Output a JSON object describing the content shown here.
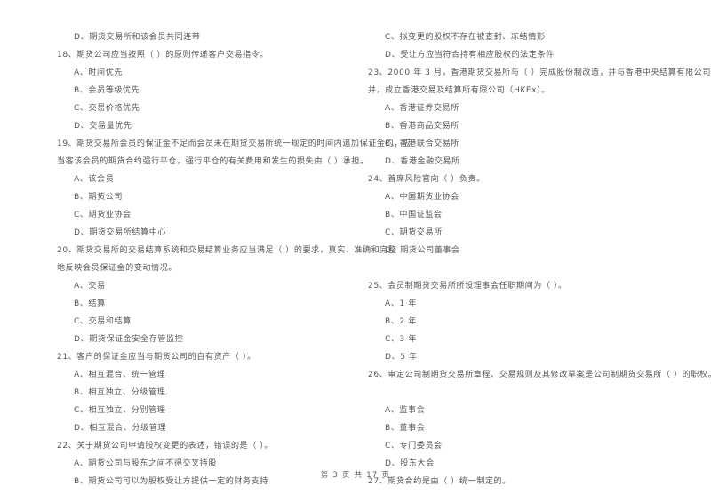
{
  "document": {
    "type": "exam-paper",
    "language": "zh-CN",
    "page_label": "第 3 页 共 17 页"
  },
  "left_column": {
    "lines": [
      {
        "kind": "option",
        "text": "D、期货交易所和该会员共同连带"
      },
      {
        "kind": "question",
        "text": "18、期货公司应当按照（    ）的原则传递客户交易指令。"
      },
      {
        "kind": "option",
        "text": "A、时间优先"
      },
      {
        "kind": "option",
        "text": "B、会员等级优先"
      },
      {
        "kind": "option",
        "text": "C、交易价格优先"
      },
      {
        "kind": "option",
        "text": "D、交易量优先"
      },
      {
        "kind": "question",
        "text": "19、期货交易所会员的保证金不足而会员未在期货交易所统一规定的时间内追加保证金的，应"
      },
      {
        "kind": "cont",
        "text": "当客该会员的期货合约强行平仓。强行平仓的有关费用和发生的损失由（    ）承担。"
      },
      {
        "kind": "option",
        "text": "A、该会员"
      },
      {
        "kind": "option",
        "text": "B、期货公司"
      },
      {
        "kind": "option",
        "text": "C、期货业协会"
      },
      {
        "kind": "option",
        "text": "D、期货交易所结算中心"
      },
      {
        "kind": "question",
        "text": "20、期货交易所的交易结算系统和交易结算业务应当满足（    ）的要求，真实、准确和完整"
      },
      {
        "kind": "cont",
        "text": "地反映会员保证金的变动情况。"
      },
      {
        "kind": "option",
        "text": "A、交易"
      },
      {
        "kind": "option",
        "text": "B、结算"
      },
      {
        "kind": "option",
        "text": "C、交易和结算"
      },
      {
        "kind": "option",
        "text": "D、期货保证金安全存管监控"
      },
      {
        "kind": "question",
        "text": "21、客户的保证金应当与期货公司的自有资产（    ）。"
      },
      {
        "kind": "option",
        "text": "A、相互混合、统一管理"
      },
      {
        "kind": "option",
        "text": "B、相互独立、分级管理"
      },
      {
        "kind": "option",
        "text": "C、相互独立、分别管理"
      },
      {
        "kind": "option",
        "text": "D、相互混合、分级管理"
      },
      {
        "kind": "question",
        "text": "22、关于期货公司申请股权变更的表述，错误的是（    ）。"
      },
      {
        "kind": "option",
        "text": "A、期货公司与股东之间不得交叉持股"
      },
      {
        "kind": "option",
        "text": "B、期货公司可以为股权受让方提供一定的财务支持"
      }
    ]
  },
  "right_column": {
    "lines": [
      {
        "kind": "option",
        "text": "C、拟变更的股权不存在被查封、冻结情形"
      },
      {
        "kind": "option",
        "text": "D、受让方应当符合持有相应股权的法定条件"
      },
      {
        "kind": "question",
        "text": "23、2000 年 3 月，香港期货交易所与（    ）完成股份制改造，并与香港中央结算有限公司合"
      },
      {
        "kind": "cont",
        "text": "并，成立香港交易及结算所有限公司（HKEx）。"
      },
      {
        "kind": "option",
        "text": "A、香港证券交易所"
      },
      {
        "kind": "option",
        "text": "B、香港商品交易所"
      },
      {
        "kind": "option",
        "text": "C、香港联合交易所"
      },
      {
        "kind": "option",
        "text": "D、香港金融交易所"
      },
      {
        "kind": "question",
        "text": "24、首席风险官向（    ）负责。"
      },
      {
        "kind": "option",
        "text": "A、中国期货业协会"
      },
      {
        "kind": "option",
        "text": "B、中国证监会"
      },
      {
        "kind": "option",
        "text": "C、期货交易所"
      },
      {
        "kind": "option",
        "text": "D、期货公司董事会"
      },
      {
        "kind": "blank",
        "text": ""
      },
      {
        "kind": "question",
        "text": "25、会员制期货交易所所设理事会任职期间为（    ）。"
      },
      {
        "kind": "option",
        "text": "A、1 年"
      },
      {
        "kind": "option",
        "text": "B、2 年"
      },
      {
        "kind": "option",
        "text": "C、3 年"
      },
      {
        "kind": "option",
        "text": "D、5 年"
      },
      {
        "kind": "question",
        "text": "26、审定公司制期货交易所章程、交易规则及其修改草案是公司制期货交易所（    ）的职权。"
      },
      {
        "kind": "blank",
        "text": ""
      },
      {
        "kind": "option",
        "text": "A、监事会"
      },
      {
        "kind": "option",
        "text": "B、董事会"
      },
      {
        "kind": "option",
        "text": "C、专门委员会"
      },
      {
        "kind": "option",
        "text": "D、股东大会"
      },
      {
        "kind": "question",
        "text": "27、期货合约是由（    ）统一制定的。"
      }
    ]
  }
}
